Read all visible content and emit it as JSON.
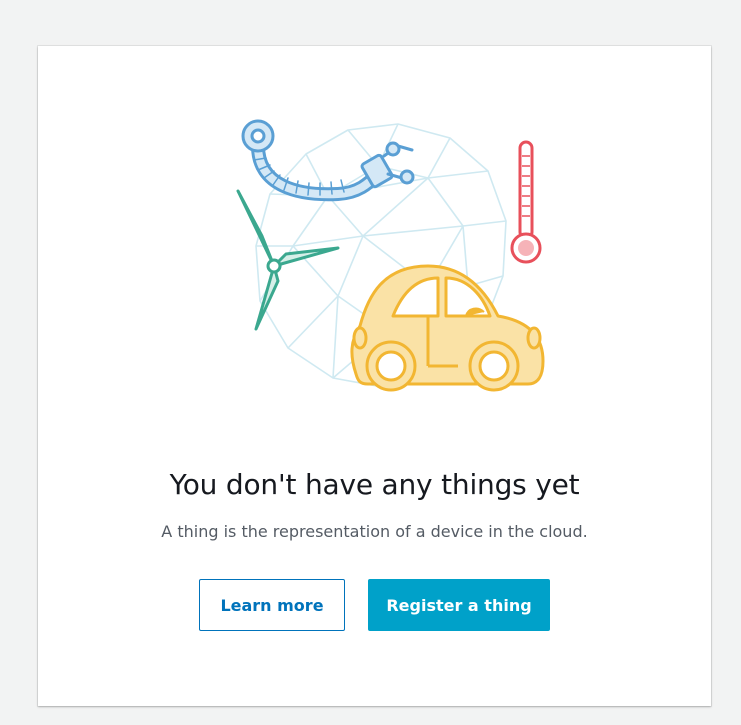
{
  "empty_state": {
    "illustration": {
      "icons": [
        "geodesic-globe-icon",
        "robot-arm-icon",
        "thermometer-icon",
        "wind-turbine-icon",
        "car-icon"
      ],
      "colors": {
        "globe": "#cfe9f1",
        "robot_arm": "#5a9fd4",
        "thermometer": "#e8505b",
        "turbine": "#3ba88f",
        "car": "#f2b632",
        "car_fill": "#fae2a6"
      }
    },
    "title": "You don't have any things yet",
    "subtitle": "A thing is the representation of a device in the cloud.",
    "learn_more_label": "Learn more",
    "register_label": "Register a thing"
  },
  "colors": {
    "page_bg": "#f2f3f3",
    "primary": "#00a1c9",
    "link": "#0073bb",
    "title": "#16191f",
    "subtitle": "#545b64"
  }
}
